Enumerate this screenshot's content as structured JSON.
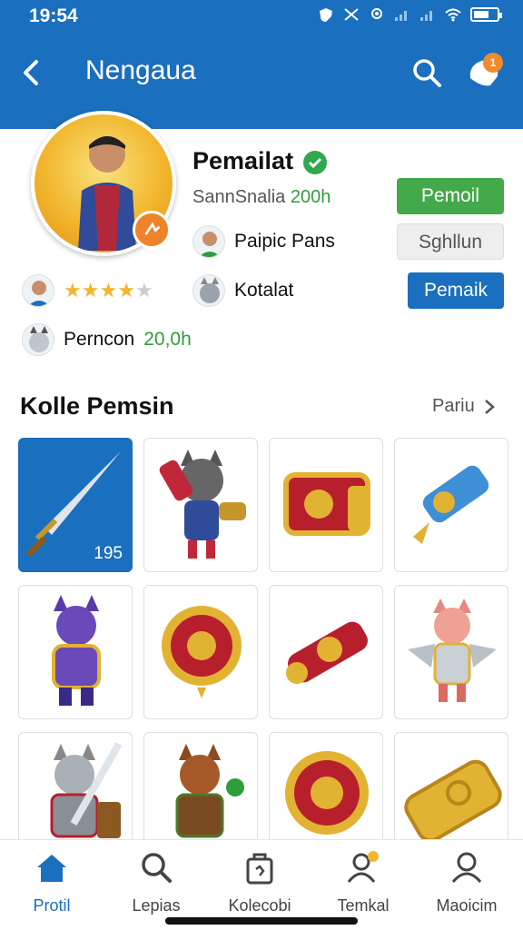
{
  "status_bar": {
    "time": "19:54",
    "battery_level": 0.65
  },
  "app_bar": {
    "title": "Nengaua",
    "notification_count": "1",
    "icons": [
      "back-arrow-icon",
      "search-icon",
      "notification-icon"
    ]
  },
  "profile": {
    "name": "Pemailat",
    "subtitle_label": "SannSnalia",
    "subtitle_value": "200h",
    "rows": [
      {
        "label": "Paipic Pans"
      },
      {
        "label": "Kotalat"
      }
    ],
    "rating_stars": 4,
    "rating_max": 5,
    "extra_label": "Perncon",
    "extra_value": "20,0h",
    "buttons": {
      "primary": "Pemoil",
      "secondary": "Sghllun",
      "tertiary": "Pemaik"
    }
  },
  "section": {
    "title": "Kolle Pemsin",
    "see_more": "Pariu",
    "items": [
      {
        "name": "sword",
        "count": "195",
        "selected": true
      },
      {
        "name": "cat-warrior-cannon"
      },
      {
        "name": "red-chest"
      },
      {
        "name": "blue-scroll"
      },
      {
        "name": "purple-cat-knight"
      },
      {
        "name": "red-gold-shield"
      },
      {
        "name": "red-cannon"
      },
      {
        "name": "pink-cat-winged"
      },
      {
        "name": "grey-cat-swordsman"
      },
      {
        "name": "brown-cat-scout"
      },
      {
        "name": "round-shield"
      },
      {
        "name": "gold-ticket"
      }
    ]
  },
  "bottom_nav": [
    {
      "label": "Protil",
      "icon": "home-icon",
      "active": true
    },
    {
      "label": "Lepias",
      "icon": "search-icon",
      "active": false
    },
    {
      "label": "Kolecobi",
      "icon": "bag-icon",
      "active": false
    },
    {
      "label": "Temkal",
      "icon": "person-badge-icon",
      "active": false
    },
    {
      "label": "Maoicim",
      "icon": "person-icon",
      "active": false
    }
  ],
  "colors": {
    "primary_blue": "#1a6fbe",
    "green": "#44a94a",
    "orange": "#f08a2c",
    "gold": "#f2b62e"
  }
}
